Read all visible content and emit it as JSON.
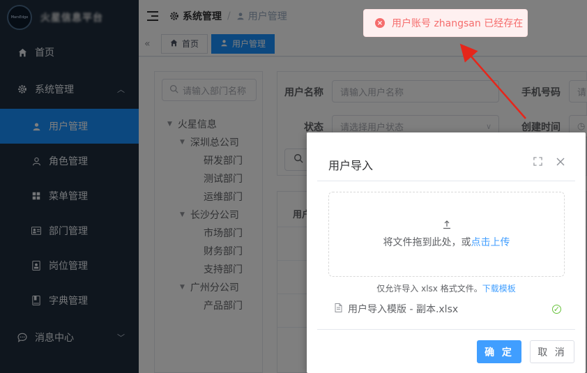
{
  "app": {
    "title": "火星信息平台",
    "logo_text": "MarsEdge"
  },
  "sidebar": {
    "items": [
      {
        "label": "首页",
        "icon": "home-icon"
      },
      {
        "label": "系统管理",
        "icon": "gear-icon",
        "expanded": true
      },
      {
        "label": "用户管理",
        "icon": "user-icon",
        "active": true
      },
      {
        "label": "角色管理",
        "icon": "user-outline-icon"
      },
      {
        "label": "菜单管理",
        "icon": "grid-icon"
      },
      {
        "label": "部门管理",
        "icon": "id-card-icon"
      },
      {
        "label": "岗位管理",
        "icon": "badge-icon"
      },
      {
        "label": "字典管理",
        "icon": "book-icon"
      },
      {
        "label": "消息中心",
        "icon": "chat-icon"
      }
    ]
  },
  "navbar": {
    "breadcrumb": [
      "系统管理",
      "用户管理"
    ]
  },
  "tags": [
    {
      "label": "首页",
      "icon": "home-icon"
    },
    {
      "label": "用户管理",
      "icon": "user-icon",
      "active": true
    }
  ],
  "dept_tree": {
    "search_placeholder": "请输入部门名称",
    "nodes": [
      {
        "label": "火星信息",
        "level": 0,
        "expanded": true
      },
      {
        "label": "深圳总公司",
        "level": 1,
        "expanded": true
      },
      {
        "label": "研发部门",
        "level": 2
      },
      {
        "label": "测试部门",
        "level": 2
      },
      {
        "label": "运维部门",
        "level": 2
      },
      {
        "label": "长沙分公司",
        "level": 1,
        "expanded": true
      },
      {
        "label": "市场部门",
        "level": 2
      },
      {
        "label": "财务部门",
        "level": 2
      },
      {
        "label": "支持部门",
        "level": 2
      },
      {
        "label": "广州分公司",
        "level": 1,
        "expanded": true
      },
      {
        "label": "产品部门",
        "level": 2
      }
    ]
  },
  "search_form": {
    "username_label": "用户名称",
    "username_placeholder": "请输入用户名称",
    "phone_label": "手机号码",
    "phone_placeholder": "请",
    "status_label": "状态",
    "status_placeholder": "请选择用户状态",
    "created_label": "创建时间"
  },
  "table": {
    "first_header": "用户"
  },
  "dialog": {
    "title": "用户导入",
    "upload_text": "将文件拖到此处，或",
    "upload_link": "点击上传",
    "tip_text": "仅允许导入 xlsx 格式文件。",
    "tip_link": "下载模板",
    "file_name": "用户导入模版 - 副本.xlsx",
    "confirm_label": "确 定",
    "cancel_label": "取 消"
  },
  "toast": {
    "message": "用户账号 zhangsan 已经存在",
    "type": "error"
  },
  "colors": {
    "sidebar_bg": "#1f2d3d",
    "accent": "#1890ff",
    "primary_button": "#409eff",
    "error": "#f56c6c",
    "success": "#67c23a",
    "annotation_arrow": "#e5261b"
  }
}
